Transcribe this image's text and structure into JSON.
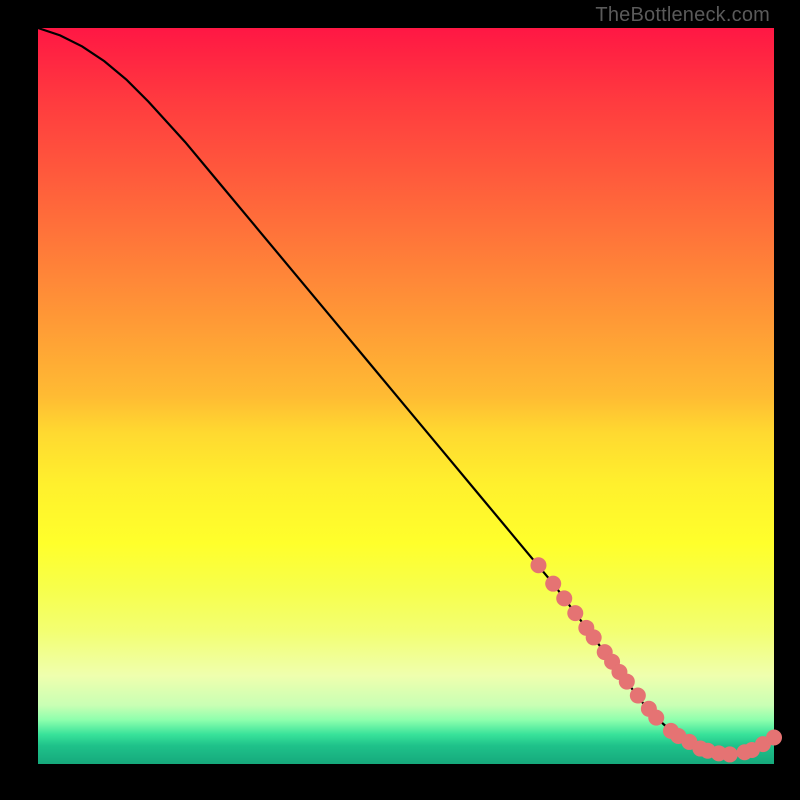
{
  "attribution": "TheBottleneck.com",
  "chart_data": {
    "type": "line",
    "title": "",
    "xlabel": "",
    "ylabel": "",
    "xlim": [
      0,
      100
    ],
    "ylim": [
      0,
      100
    ],
    "series": [
      {
        "name": "curve",
        "x": [
          0,
          3,
          6,
          9,
          12,
          15,
          20,
          25,
          30,
          35,
          40,
          45,
          50,
          55,
          60,
          65,
          70,
          73,
          76,
          79,
          82,
          84,
          86,
          88,
          90,
          92,
          94,
          96,
          98,
          100
        ],
        "y": [
          100,
          99,
          97.5,
          95.5,
          93,
          90,
          84.5,
          78.5,
          72.5,
          66.5,
          60.5,
          54.5,
          48.5,
          42.5,
          36.5,
          30.5,
          24.5,
          20.5,
          16.5,
          12.5,
          8.5,
          6.3,
          4.5,
          3.1,
          2.1,
          1.5,
          1.3,
          1.6,
          2.4,
          3.6
        ]
      }
    ],
    "markers": {
      "x": [
        68,
        70,
        71.5,
        73,
        74.5,
        75.5,
        77,
        78,
        79,
        80,
        81.5,
        83,
        84,
        86,
        87,
        88.5,
        90,
        91,
        92.5,
        94,
        96,
        97,
        98.5,
        100
      ],
      "y": [
        27,
        24.5,
        22.5,
        20.5,
        18.5,
        17.2,
        15.2,
        13.9,
        12.5,
        11.2,
        9.3,
        7.5,
        6.3,
        4.5,
        3.8,
        3.0,
        2.1,
        1.8,
        1.45,
        1.3,
        1.6,
        1.9,
        2.7,
        3.6
      ],
      "color": "#e57373",
      "radius": 8
    }
  }
}
